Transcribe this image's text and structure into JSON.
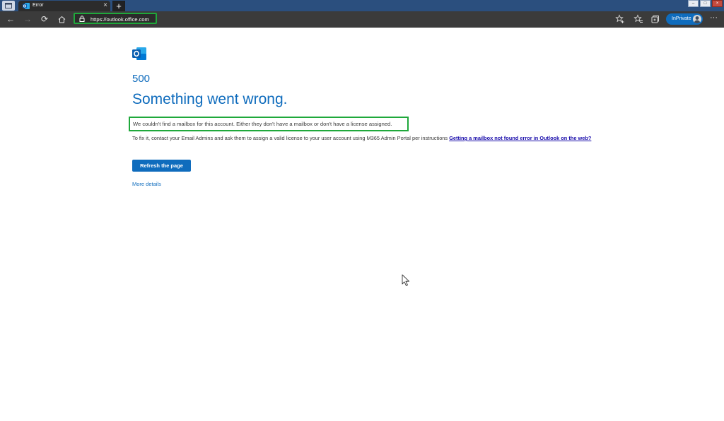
{
  "browser": {
    "tab": {
      "title": "Error"
    },
    "address_bar": {
      "url": "https://outlook.office.com"
    },
    "inprivate_label": "InPrivate",
    "icons": [
      "tab-actions-icon",
      "outlook-favicon",
      "close-icon",
      "new-tab-icon",
      "back-icon",
      "forward-icon",
      "refresh-icon",
      "home-icon",
      "lock-icon",
      "add-favorite-icon",
      "favorites-icon",
      "collections-icon",
      "avatar",
      "more-icon"
    ]
  },
  "page": {
    "error_code": "500",
    "heading": "Something went wrong.",
    "message": "We couldn't find a mailbox for this account. Either they don't have a mailbox or don't have a license assigned.",
    "fix_text": "To fix it, contact your Email Admins and ask them to assign a valid license to your user account using M365 Admin Portal per instructions",
    "fix_link": "Getting a mailbox not found error in Outlook on the web?",
    "refresh_button": "Refresh the page",
    "more_details": "More details"
  },
  "colors": {
    "accent": "#0f6cbd",
    "highlight_box": "#1fa83b",
    "toolbar": "#3b3b3b",
    "tabstrip": "#2b4f7e"
  }
}
